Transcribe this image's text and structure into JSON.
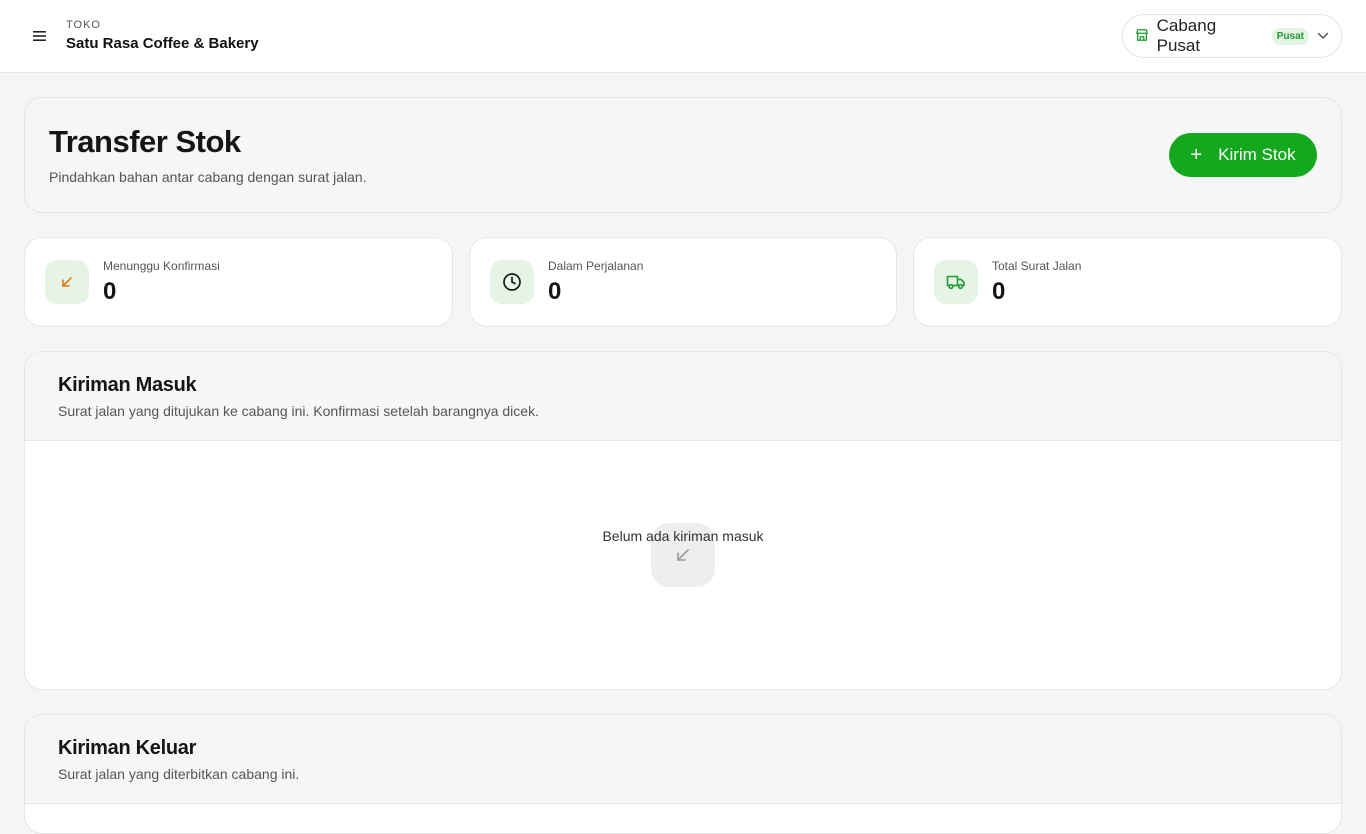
{
  "topbar": {
    "store_label": "TOKO",
    "store_name": "Satu Rasa Coffee & Bakery",
    "branch": {
      "name": "Cabang Pusat",
      "badge": "Pusat"
    }
  },
  "header": {
    "title": "Transfer Stok",
    "subtitle": "Pindahkan bahan antar cabang dengan surat jalan.",
    "send_button_label": "Kirim Stok"
  },
  "stats": [
    {
      "label": "Menunggu Konfirmasi",
      "value": "0",
      "icon": "arrow-down-left-icon"
    },
    {
      "label": "Dalam Perjalanan",
      "value": "0",
      "icon": "clock-icon"
    },
    {
      "label": "Total Surat Jalan",
      "value": "0",
      "icon": "truck-icon"
    }
  ],
  "incoming": {
    "title": "Kiriman Masuk",
    "subtitle": "Surat jalan yang ditujukan ke cabang ini. Konfirmasi setelah barangnya dicek.",
    "empty_text": "Belum ada kiriman masuk"
  },
  "outgoing": {
    "title": "Kiriman Keluar",
    "subtitle": "Surat jalan yang diterbitkan cabang ini."
  },
  "colors": {
    "accent": "#14a81e",
    "accent_soft": "#e6f4e6",
    "warning_icon": "#e07b1a"
  }
}
